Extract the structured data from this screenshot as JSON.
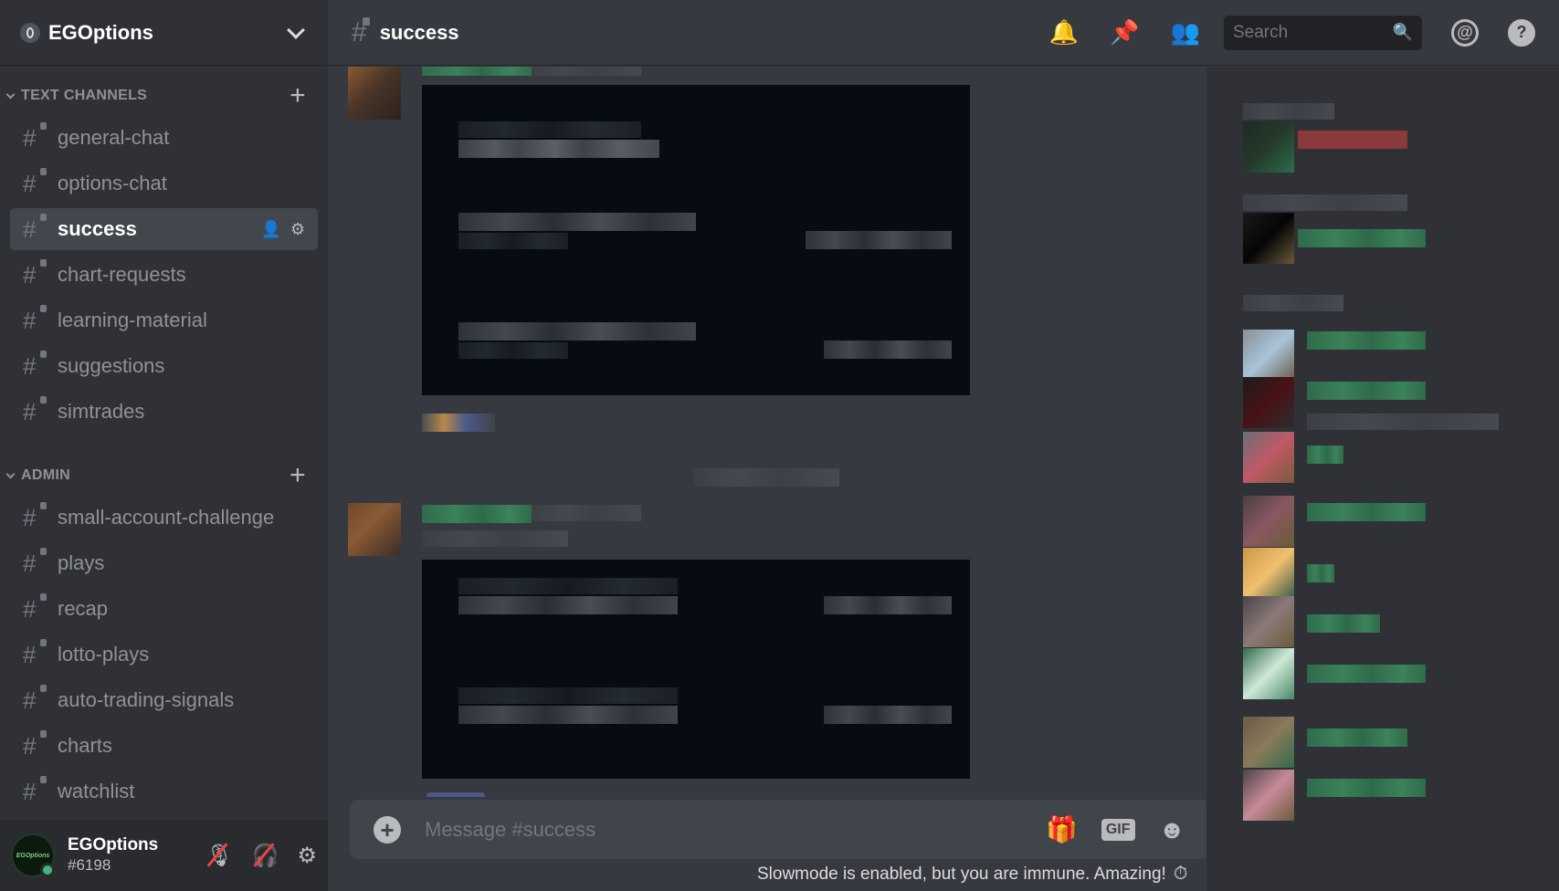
{
  "server": {
    "name": "EGOptions"
  },
  "categories": [
    {
      "name": "TEXT CHANNELS",
      "channels": [
        "general-chat",
        "options-chat",
        "success",
        "chart-requests",
        "learning-material",
        "suggestions",
        "simtrades"
      ]
    },
    {
      "name": "ADMIN",
      "channels": [
        "small-account-challenge",
        "plays",
        "recap",
        "lotto-plays",
        "auto-trading-signals",
        "charts",
        "watchlist"
      ]
    }
  ],
  "active_channel": "success",
  "header": {
    "channel_title": "success",
    "search_placeholder": "Search"
  },
  "user": {
    "name": "EGOptions",
    "tag": "#6198",
    "avatar_text": "EGOptions"
  },
  "composer": {
    "placeholder": "Message #success",
    "gif_label": "GIF"
  },
  "slowmode_text": "Slowmode is enabled, but you are immune. Amazing!",
  "icons": {
    "bell": "bell-icon",
    "pin": "pin-icon",
    "members": "members-icon",
    "search": "search-icon",
    "mention": "mention-icon",
    "help": "help-icon",
    "gift": "gift-icon",
    "emoji": "emoji-icon",
    "timer": "timer-icon"
  },
  "colors": {
    "accent_online": "#43b581",
    "sidebar_bg": "#2f3136",
    "chat_bg": "#36393f",
    "embed_bg": "#060b14",
    "muted_red": "#ed4245"
  }
}
